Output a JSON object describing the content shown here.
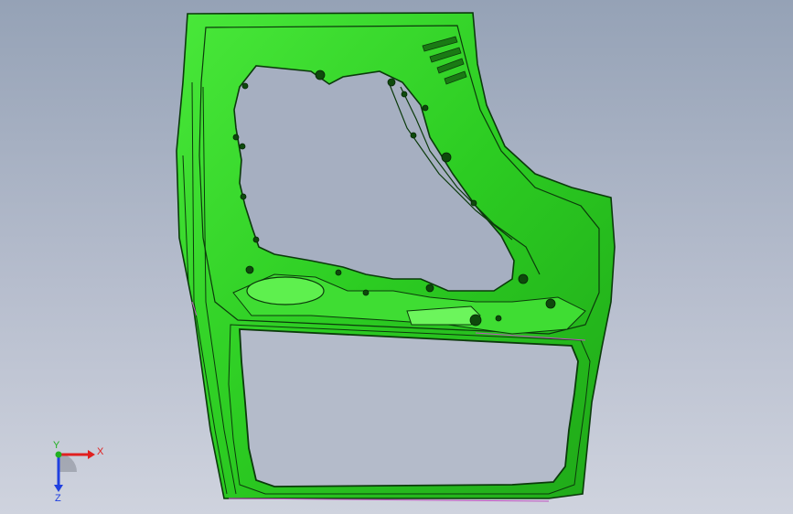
{
  "viewport": {
    "background_top": "#95a2b6",
    "background_bottom": "#cfd3de",
    "model_color": "#2fd12a",
    "model_edge_color": "#0b3a0b",
    "model_highlight": "#7dff6a"
  },
  "model": {
    "name_icon": "car-door-inner-panel-model"
  },
  "triad": {
    "x_label": "X",
    "y_label": "Y",
    "z_label": "Z",
    "x_color": "#e02020",
    "y_color": "#20b020",
    "z_color": "#2040e0"
  }
}
